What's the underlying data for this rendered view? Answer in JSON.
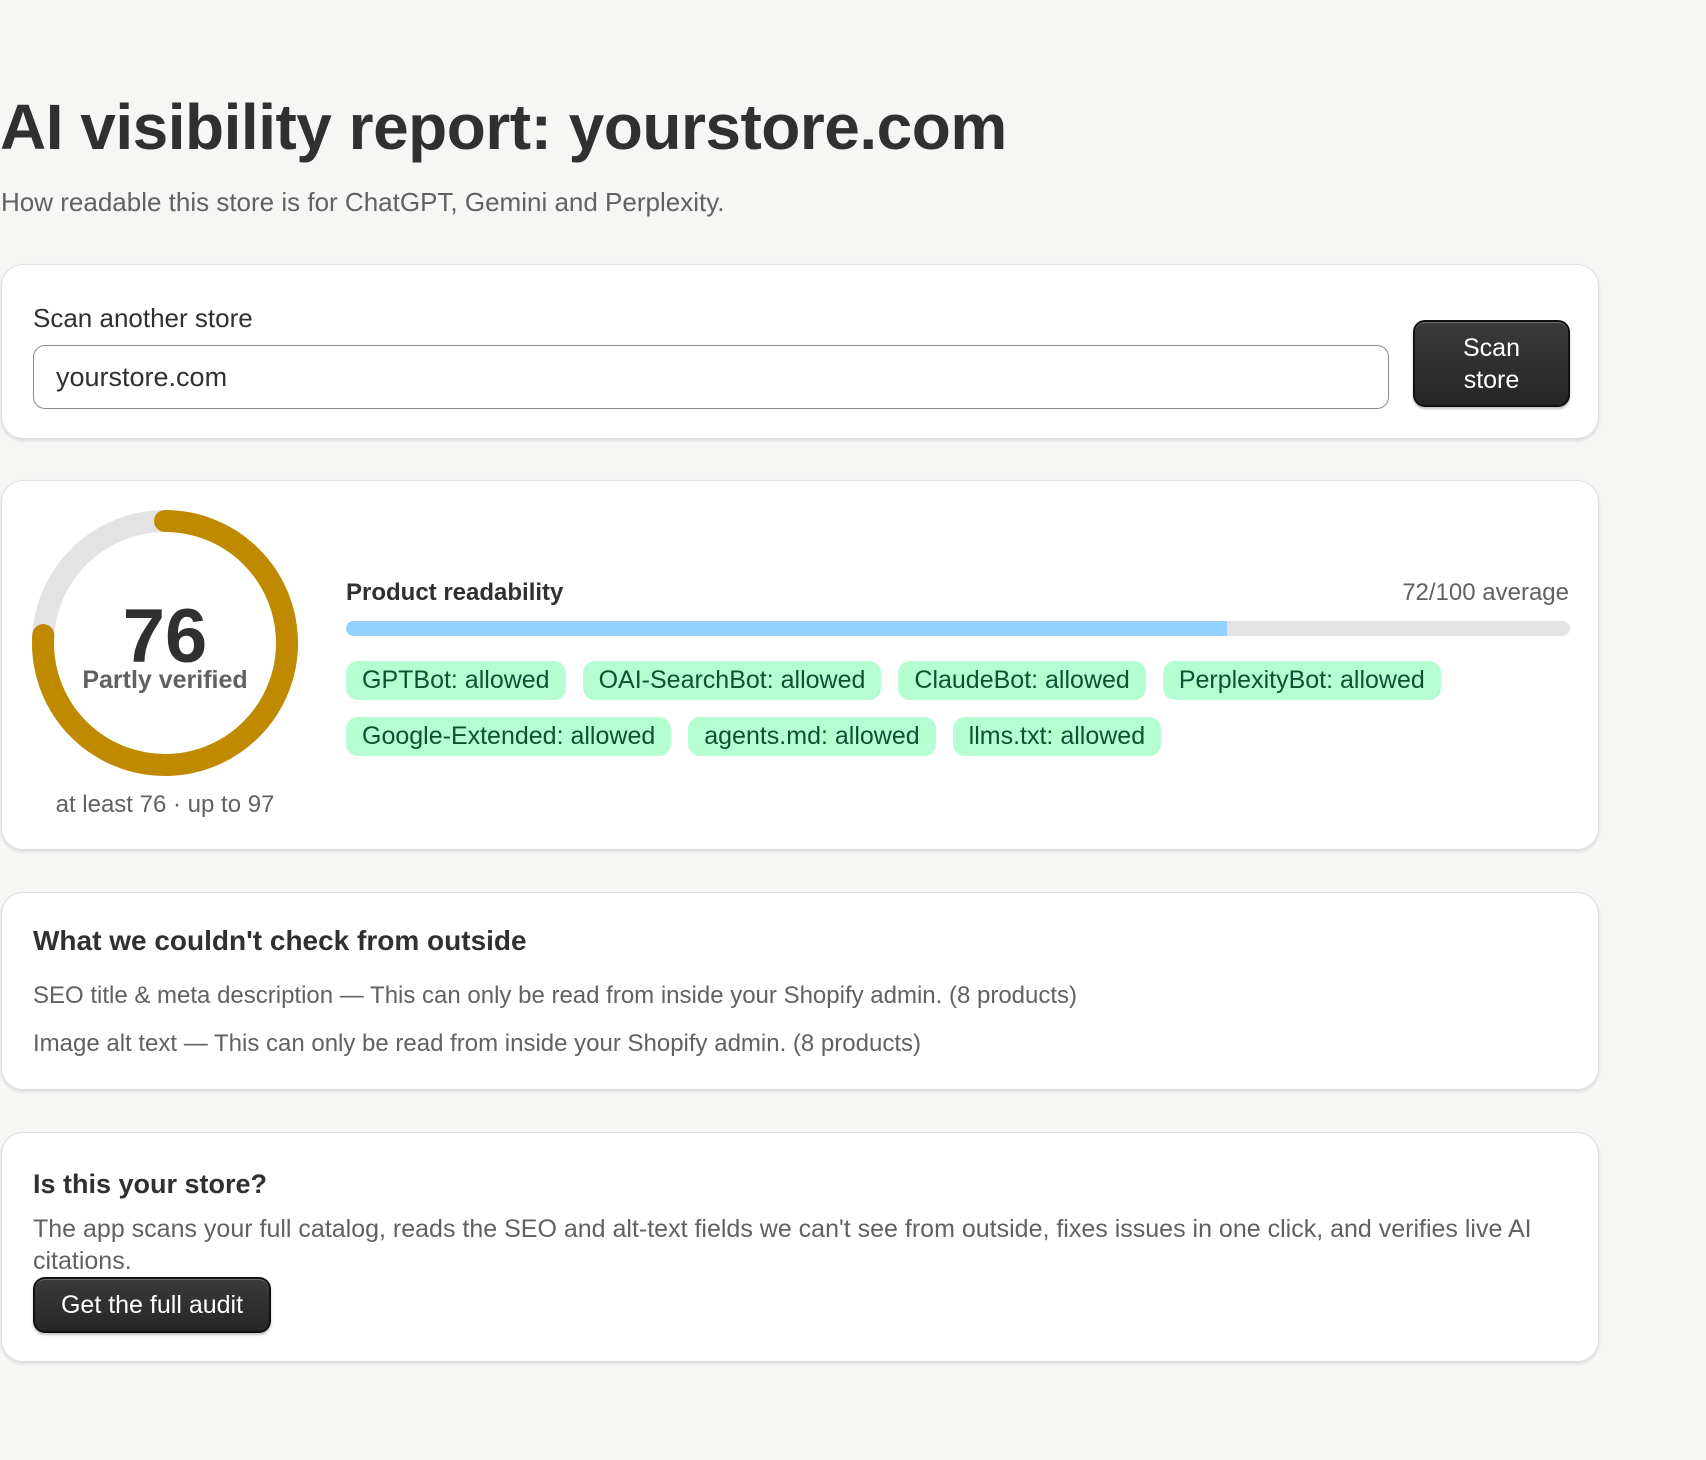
{
  "header": {
    "title": "AI visibility report: yourstore.com",
    "subtitle": "How readable this store is for ChatGPT, Gemini and Perplexity."
  },
  "scan": {
    "label": "Scan another store",
    "input_value": "yourstore.com",
    "button_label": "Scan store"
  },
  "score": {
    "value": "76",
    "fraction": 0.76,
    "status": "Partly verified",
    "range_text": "at least 76 · up to 97",
    "colors": {
      "arc": "#bf8a00",
      "track": "#e3e3e3"
    }
  },
  "readability": {
    "label": "Product readability",
    "average_text": "72/100 average",
    "value": 72,
    "max": 100,
    "fill_color": "#91d0ff"
  },
  "bots": [
    "GPTBot: allowed",
    "OAI-SearchBot: allowed",
    "ClaudeBot: allowed",
    "PerplexityBot: allowed",
    "Google-Extended: allowed",
    "agents.md: allowed",
    "llms.txt: allowed"
  ],
  "unchecked": {
    "title": "What we couldn't check from outside",
    "items": [
      "SEO title & meta description — This can only be read from inside your Shopify admin. (8 products)",
      "Image alt text — This can only be read from inside your Shopify admin. (8 products)"
    ]
  },
  "cta": {
    "title": "Is this your store?",
    "body": "The app scans your full catalog, reads the SEO and alt-text fields we can't see from outside, fixes issues in one click, and verifies live AI citations.",
    "button_label": "Get the full audit"
  }
}
